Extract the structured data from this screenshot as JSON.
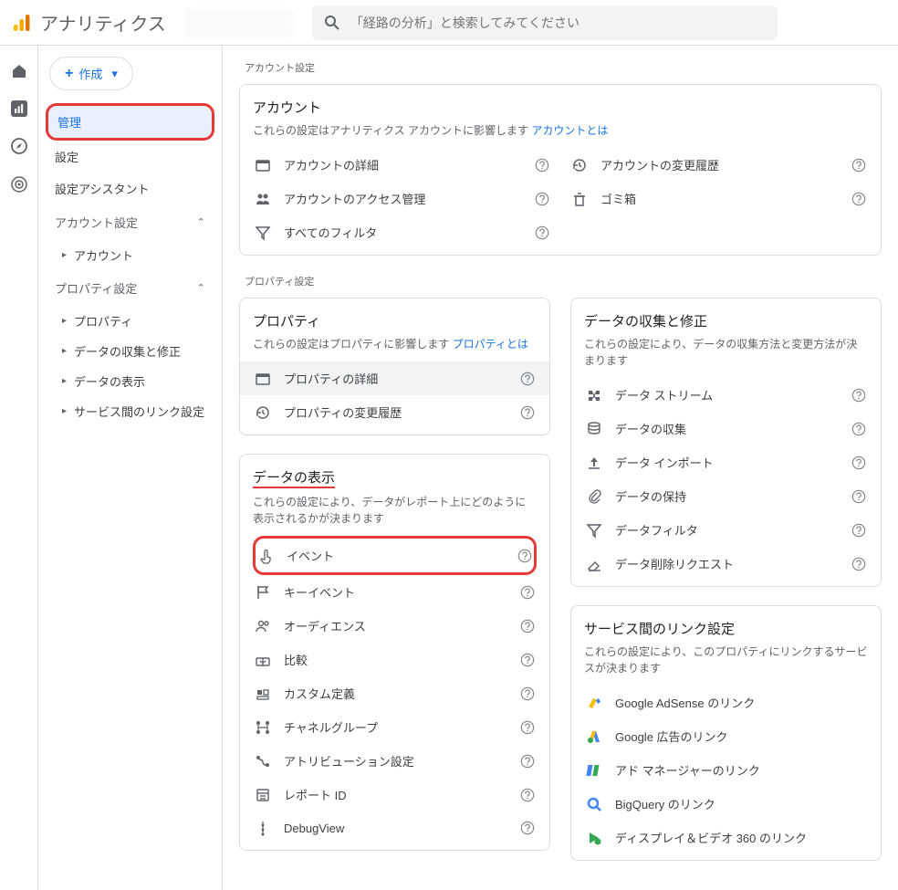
{
  "header": {
    "app_name": "アナリティクス",
    "search_placeholder": "「経路の分析」と検索してみてください"
  },
  "sidebar": {
    "create_label": "作成",
    "items": {
      "admin": "管理",
      "settings": "設定",
      "assistant": "設定アシスタント"
    },
    "account_group": "アカウント設定",
    "account_sub": [
      "アカウント"
    ],
    "property_group": "プロパティ設定",
    "property_sub": [
      "プロパティ",
      "データの収集と修正",
      "データの表示",
      "サービス間のリンク設定"
    ]
  },
  "sections": {
    "account_settings_label": "アカウント設定",
    "property_settings_label": "プロパティ設定"
  },
  "account_card": {
    "title": "アカウント",
    "desc": "これらの設定はアナリティクス アカウントに影響します ",
    "link": "アカウントとは",
    "items_left": [
      {
        "icon": "card-account",
        "label": "アカウントの詳細"
      },
      {
        "icon": "people",
        "label": "アカウントのアクセス管理"
      },
      {
        "icon": "filter",
        "label": "すべてのフィルタ"
      }
    ],
    "items_right": [
      {
        "icon": "history",
        "label": "アカウントの変更履歴"
      },
      {
        "icon": "trash",
        "label": "ゴミ箱"
      }
    ]
  },
  "property_card": {
    "title": "プロパティ",
    "desc": "これらの設定はプロパティに影響します ",
    "link": "プロパティとは",
    "items": [
      {
        "icon": "card-account",
        "label": "プロパティの詳細",
        "selected": true
      },
      {
        "icon": "history",
        "label": "プロパティの変更履歴"
      }
    ]
  },
  "data_collect_card": {
    "title": "データの収集と修正",
    "desc": "これらの設定により、データの収集方法と変更方法が決まります",
    "items": [
      {
        "icon": "stream",
        "label": "データ ストリーム"
      },
      {
        "icon": "database",
        "label": "データの収集"
      },
      {
        "icon": "upload",
        "label": "データ インポート"
      },
      {
        "icon": "attach",
        "label": "データの保持"
      },
      {
        "icon": "filter",
        "label": "データフィルタ"
      },
      {
        "icon": "eraser",
        "label": "データ削除リクエスト"
      }
    ]
  },
  "data_display_card": {
    "title": "データの表示",
    "desc": "これらの設定により、データがレポート上にどのように表示されるかが決まります",
    "items": [
      {
        "icon": "touch",
        "label": "イベント",
        "redbox": true
      },
      {
        "icon": "flag",
        "label": "キーイベント"
      },
      {
        "icon": "people-outline",
        "label": "オーディエンス"
      },
      {
        "icon": "compare",
        "label": "比較"
      },
      {
        "icon": "custom",
        "label": "カスタム定義"
      },
      {
        "icon": "channel",
        "label": "チャネルグループ"
      },
      {
        "icon": "attribution",
        "label": "アトリビューション設定"
      },
      {
        "icon": "report-id",
        "label": "レポート ID"
      },
      {
        "icon": "bug",
        "label": "DebugView"
      }
    ]
  },
  "links_card": {
    "title": "サービス間のリンク設定",
    "desc": "これらの設定により、このプロパティにリンクするサービスが決まります",
    "items": [
      {
        "icon": "adsense",
        "label": "Google AdSense のリンク"
      },
      {
        "icon": "ads",
        "label": "Google 広告のリンク"
      },
      {
        "icon": "admanager",
        "label": "アド マネージャーのリンク"
      },
      {
        "icon": "bigquery",
        "label": "BigQuery のリンク"
      },
      {
        "icon": "dv360",
        "label": "ディスプレイ＆ビデオ 360 のリンク"
      }
    ]
  }
}
